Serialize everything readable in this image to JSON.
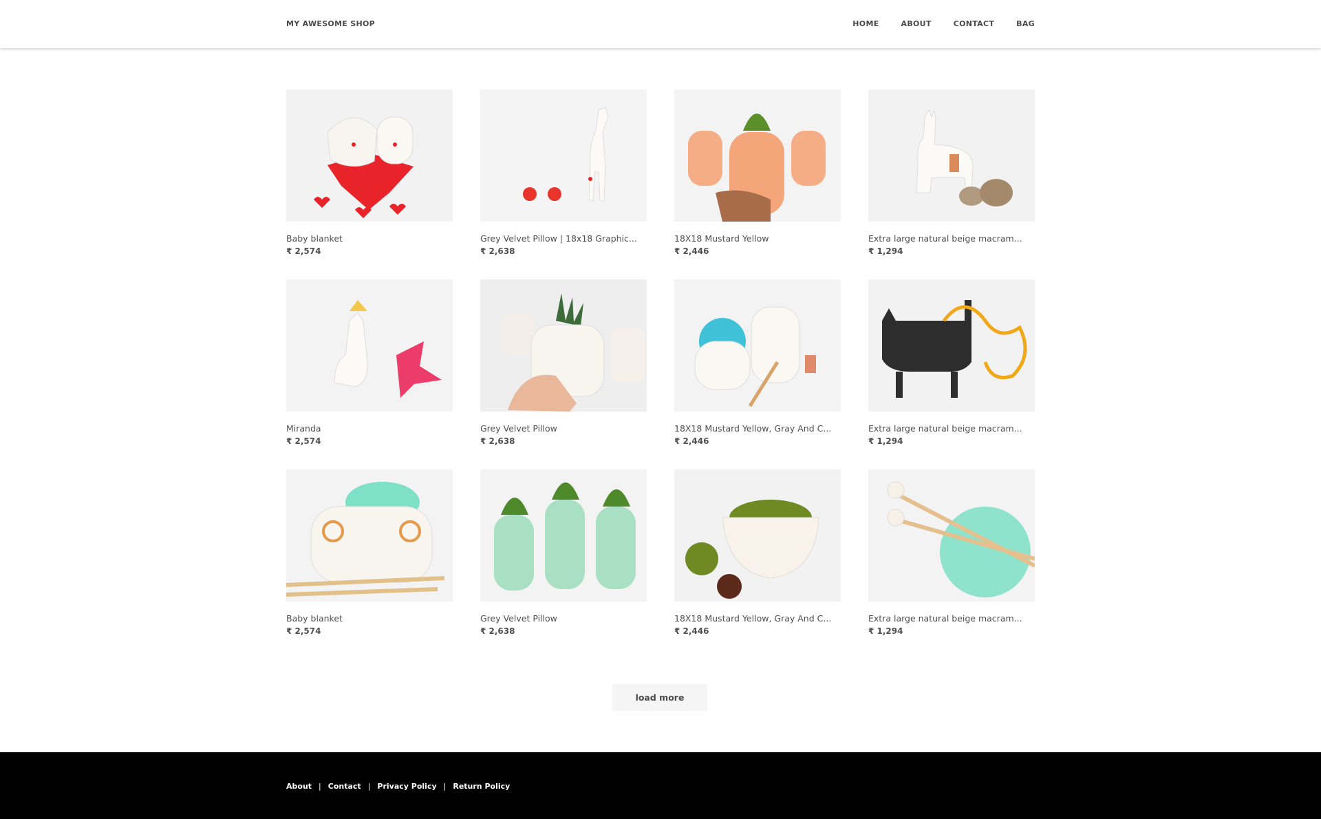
{
  "header": {
    "brand": "MY AWESOME SHOP",
    "nav": [
      "HOME",
      "ABOUT",
      "CONTACT",
      "BAG"
    ]
  },
  "products": [
    {
      "title": "Baby blanket",
      "price": "₹ 2,574",
      "image": "ceramic-lovers-on-red-heart"
    },
    {
      "title": "Grey Velvet Pillow | 18x18 Graphic...",
      "price": "₹ 2,638",
      "image": "ceramic-giraffe-with-red-balls"
    },
    {
      "title": "18X18 Mustard Yellow",
      "price": "₹ 2,446",
      "image": "peach-bear-cactus-planters"
    },
    {
      "title": "Extra large natural beige macram...",
      "price": "₹ 1,294",
      "image": "ceramic-llama-with-stones"
    },
    {
      "title": "Miranda",
      "price": "₹ 2,574",
      "image": "llama-figurine-with-pink-flower"
    },
    {
      "title": "Grey Velvet Pillow",
      "price": "₹ 2,638",
      "image": "succulent-planter-in-hand"
    },
    {
      "title": "18X18 Mustard Yellow, Gray And C...",
      "price": "₹ 2,446",
      "image": "llama-yarn-bowl"
    },
    {
      "title": "Extra large natural beige macram...",
      "price": "₹ 1,294",
      "image": "black-cat-planter-with-ribbon"
    },
    {
      "title": "Baby blanket",
      "price": "₹ 2,574",
      "image": "sheep-yarn-bowl-with-needles"
    },
    {
      "title": "Grey Velvet Pillow",
      "price": "₹ 2,638",
      "image": "mint-monkey-planters"
    },
    {
      "title": "18X18 Mustard Yellow, Gray And C...",
      "price": "₹ 2,446",
      "image": "hedgehog-planter-with-moss"
    },
    {
      "title": "Extra large natural beige macram...",
      "price": "₹ 1,294",
      "image": "knitting-needles-in-mint-yarn"
    }
  ],
  "load_more_label": "load more",
  "footer": {
    "links": [
      "About",
      "Contact",
      "Privacy Policy",
      "Return Policy"
    ],
    "separator": "|"
  },
  "colors": {
    "accent_red": "#e8242a",
    "mint": "#7fe0c8",
    "peach": "#f4a57a",
    "mustard": "#f0a818"
  }
}
